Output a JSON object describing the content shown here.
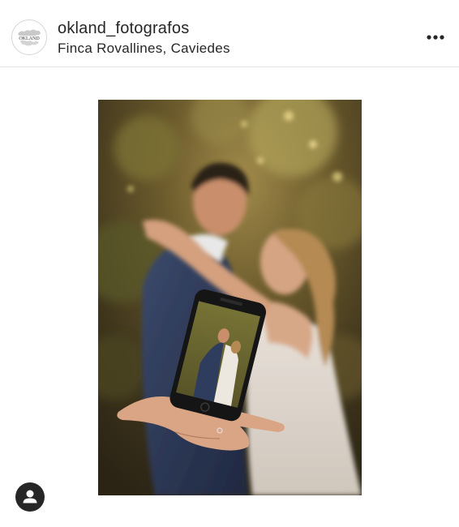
{
  "post": {
    "username": "okland_fotografos",
    "location": "Finca Rovallines, Caviedes",
    "avatar_logo_text": "OKLAND",
    "icons": {
      "more": "more-options-icon",
      "tag": "user-tag-icon"
    }
  }
}
